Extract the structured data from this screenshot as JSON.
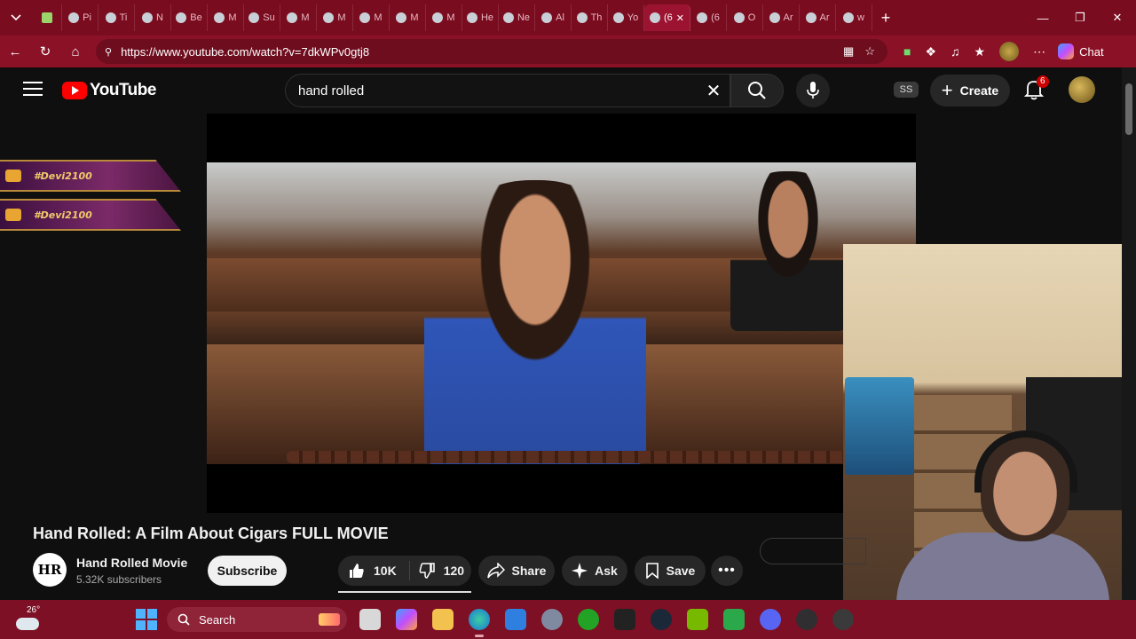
{
  "browser": {
    "tabs": [
      {
        "label": "Pi",
        "active": false
      },
      {
        "label": "Ti",
        "active": false
      },
      {
        "label": "N",
        "active": false
      },
      {
        "label": "Be",
        "active": false
      },
      {
        "label": "M",
        "active": false
      },
      {
        "label": "Su",
        "active": false
      },
      {
        "label": "M",
        "active": false
      },
      {
        "label": "M",
        "active": false
      },
      {
        "label": "M",
        "active": false
      },
      {
        "label": "M",
        "active": false
      },
      {
        "label": "M",
        "active": false
      },
      {
        "label": "He",
        "active": false
      },
      {
        "label": "Ne",
        "active": false
      },
      {
        "label": "Al",
        "active": false
      },
      {
        "label": "Th",
        "active": false
      },
      {
        "label": "Yo",
        "active": false
      },
      {
        "label": "(6",
        "active": true
      },
      {
        "label": "(6",
        "active": false
      },
      {
        "label": "O",
        "active": false
      },
      {
        "label": "Ar",
        "active": false
      },
      {
        "label": "Ar",
        "active": false
      },
      {
        "label": "w",
        "active": false
      }
    ],
    "url": "https://www.youtube.com/watch?v=7dkWPv0gtj8",
    "chat_label": "Chat"
  },
  "youtube": {
    "logo_text": "YouTube",
    "search_value": "hand rolled",
    "ss_badge": "SS",
    "create_label": "Create",
    "notification_count": "6"
  },
  "overlay": {
    "handle_1": "#Devi2100",
    "handle_2": "#Devi2100"
  },
  "video": {
    "title": "Hand Rolled: A Film About Cigars FULL MOVIE",
    "channel_initials": "HR",
    "channel_name": "Hand Rolled Movie",
    "subscribers": "5.32K subscribers",
    "subscribe_label": "Subscribe",
    "likes": "10K",
    "dislikes": "120",
    "share_label": "Share",
    "ask_label": "Ask",
    "save_label": "Save"
  },
  "taskbar": {
    "temperature": "26°",
    "search_label": "Search"
  },
  "colors": {
    "browser_frame": "#7a0c1f",
    "youtube_red": "#ff0000",
    "page_bg": "#0f0f0f"
  }
}
